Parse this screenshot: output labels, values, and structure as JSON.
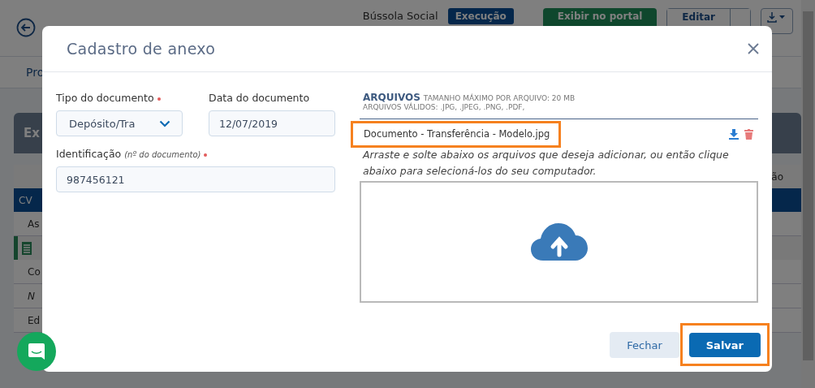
{
  "page": {
    "brand": "Bússola Social",
    "status_badge": "Execução",
    "portal_button": "Exibir no portal",
    "edit_button": "Editar",
    "tab": "Pro",
    "card_title": "Ex",
    "table_header": [
      "CV",
      "ão"
    ],
    "rows": [
      "As",
      "Co",
      "N",
      "Ed"
    ]
  },
  "modal": {
    "title": "Cadastro de anexo",
    "fields": [
      {
        "label": "Tipo do documento",
        "required": true,
        "kind": "select",
        "value": "Depósito/Tra"
      },
      {
        "label": "Data do documento",
        "required": false,
        "kind": "text",
        "value": "12/07/2019"
      },
      {
        "label": "Identificação",
        "hint": "(nº do documento)",
        "required": true,
        "kind": "text",
        "value": "987456121"
      }
    ],
    "files": {
      "heading": "ARQUIVOS",
      "max_size": "TAMANHO MÁXIMO POR ARQUIVO: 20 MB",
      "valid_types": "ARQUIVOS VÁLIDOS: .JPG, .JPEG, .PNG, .PDF,",
      "items": [
        {
          "name": "Documento - Transferência - Modelo.jpg",
          "highlighted": true
        }
      ],
      "instructions": "Arraste e solte abaixo os arquivos que deseja adicionar, ou então clique abaixo para selecioná-los do seu computador."
    },
    "buttons": [
      {
        "label": "Fechar",
        "kind": "secondary",
        "highlighted": false
      },
      {
        "label": "Salvar",
        "kind": "primary",
        "highlighted": true
      }
    ]
  }
}
